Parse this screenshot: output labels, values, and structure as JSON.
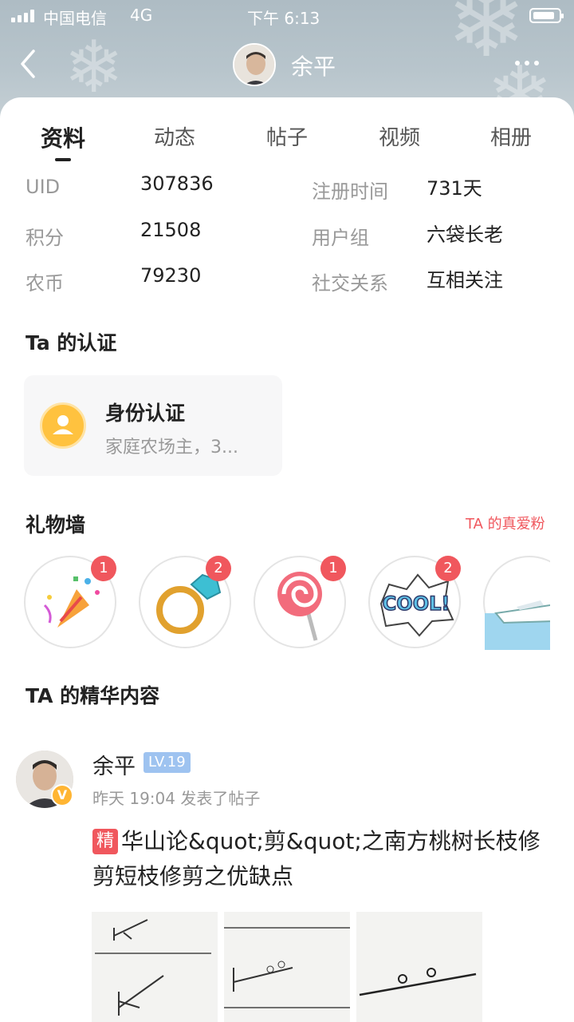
{
  "status_bar": {
    "carrier": "中国电信",
    "network": "4G",
    "time": "下午 6:13"
  },
  "nav": {
    "name": "余平",
    "back_icon": "chevron-left-icon",
    "more_icon": "more-icon"
  },
  "tabs": [
    "资料",
    "动态",
    "帖子",
    "视频",
    "相册"
  ],
  "active_tab": "资料",
  "profile": {
    "left": [
      {
        "label": "UID",
        "value": "307836"
      },
      {
        "label": "积分",
        "value": "21508"
      },
      {
        "label": "农币",
        "value": "79230"
      }
    ],
    "right": [
      {
        "label": "注册时间",
        "value": "731天"
      },
      {
        "label": "用户组",
        "value": "六袋长老"
      },
      {
        "label": "社交关系",
        "value": "互相关注"
      }
    ]
  },
  "certification": {
    "section_title": "Ta 的认证",
    "title": "身份认证",
    "subtitle": "家庭农场主，3..."
  },
  "gift_wall": {
    "section_title": "礼物墙",
    "fans_link": "TA 的真爱粉",
    "gifts": [
      {
        "icon": "party-popper-icon",
        "count": "1"
      },
      {
        "icon": "diamond-ring-icon",
        "count": "2"
      },
      {
        "icon": "lollipop-icon",
        "count": "1"
      },
      {
        "icon": "cool-sticker-icon",
        "count": "2"
      },
      {
        "icon": "yacht-icon",
        "count": ""
      }
    ]
  },
  "featured": {
    "section_title": "TA 的精华内容",
    "post": {
      "author": "余平",
      "level": "LV.19",
      "meta": "昨天 19:04 发表了帖子",
      "tag": "精",
      "title": "华山论&quot;剪&quot;之南方桃树长枝修剪短枝修剪之优缺点"
    }
  },
  "colors": {
    "accent_red": "#f0575d",
    "level_blue": "#9ec3f0",
    "cert_yellow": "#ffc23f"
  }
}
